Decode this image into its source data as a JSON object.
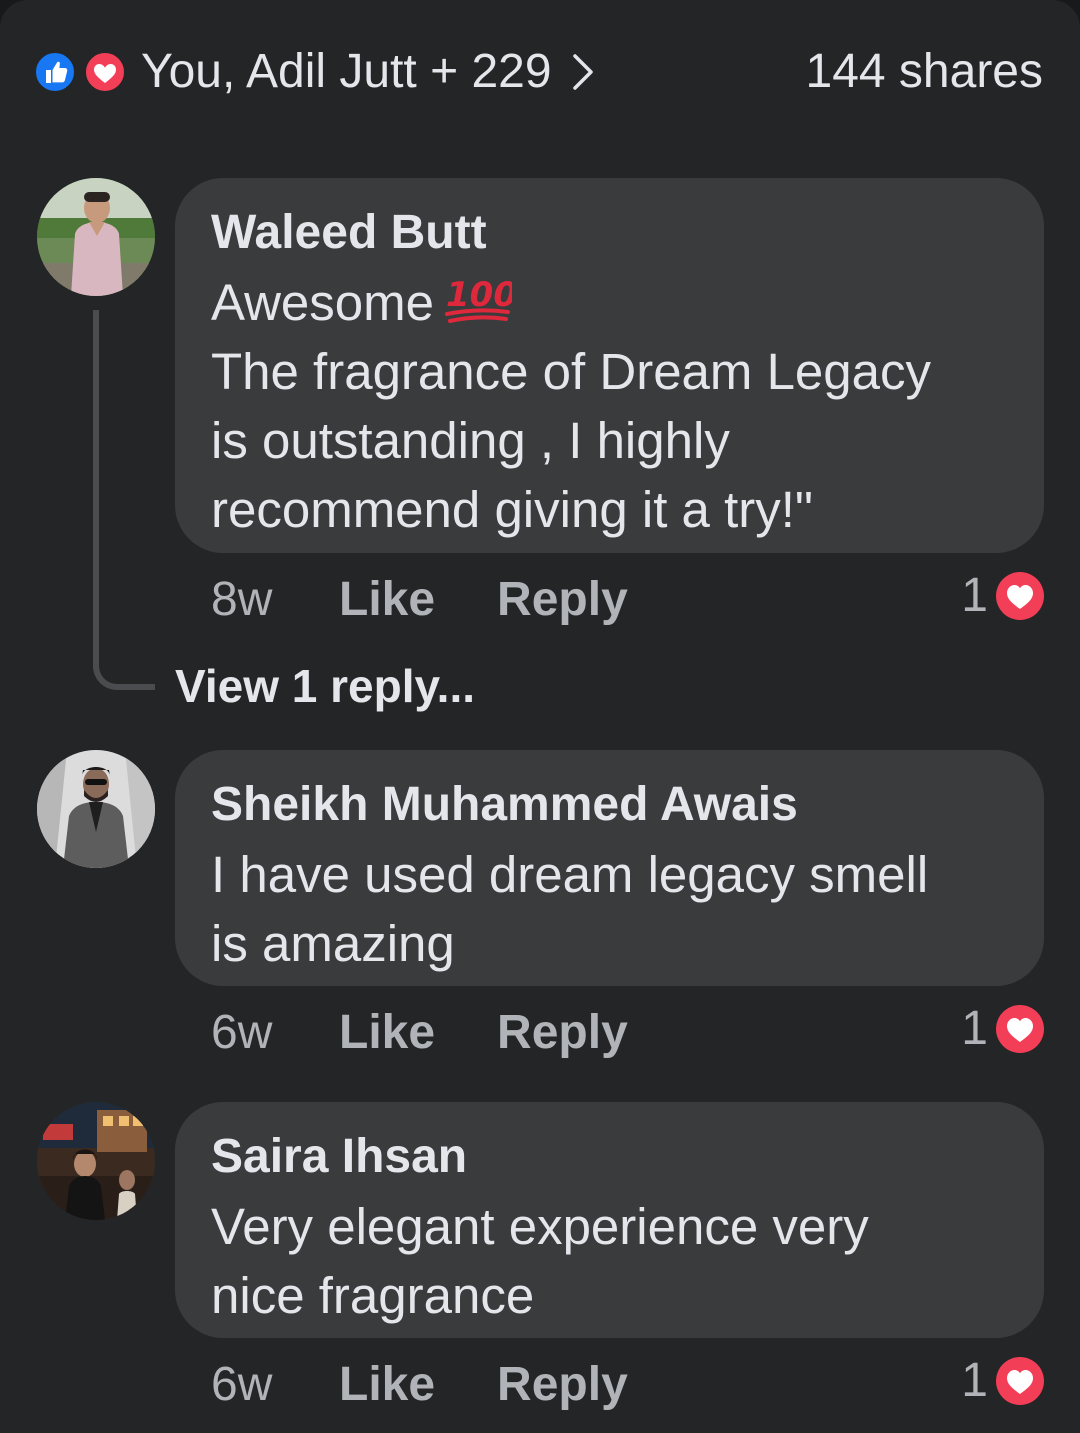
{
  "reactions_bar": {
    "summary": "You, Adil Jutt + 229",
    "shares": "144 shares",
    "icons": [
      "like-icon",
      "love-icon",
      "chevron-right-icon"
    ]
  },
  "comments": [
    {
      "author": "Waleed Butt",
      "lines": [
        "Awesome",
        "The fragrance of Dream Legacy",
        "is outstanding , I highly",
        "recommend giving it a try!\""
      ],
      "emoji": "💯",
      "time": "8w",
      "like_label": "Like",
      "reply_label": "Reply",
      "reaction_count": "1",
      "reaction_type": "love",
      "view_replies": "View 1 reply..."
    },
    {
      "author": "Sheikh Muhammed Awais",
      "lines": [
        "I have used dream legacy smell",
        "is amazing"
      ],
      "time": "6w",
      "like_label": "Like",
      "reply_label": "Reply",
      "reaction_count": "1",
      "reaction_type": "love"
    },
    {
      "author": "Saira Ihsan",
      "lines": [
        "Very elegant experience very",
        "nice fragrance"
      ],
      "time": "6w",
      "like_label": "Like",
      "reply_label": "Reply",
      "reaction_count": "1",
      "reaction_type": "love"
    }
  ],
  "colors": {
    "background": "#242526",
    "bubble": "#3a3b3c",
    "primary_text": "#e4e6eb",
    "secondary_text": "#b0b3b8",
    "like_blue": "#1877f2",
    "love_red": "#f33e58"
  }
}
